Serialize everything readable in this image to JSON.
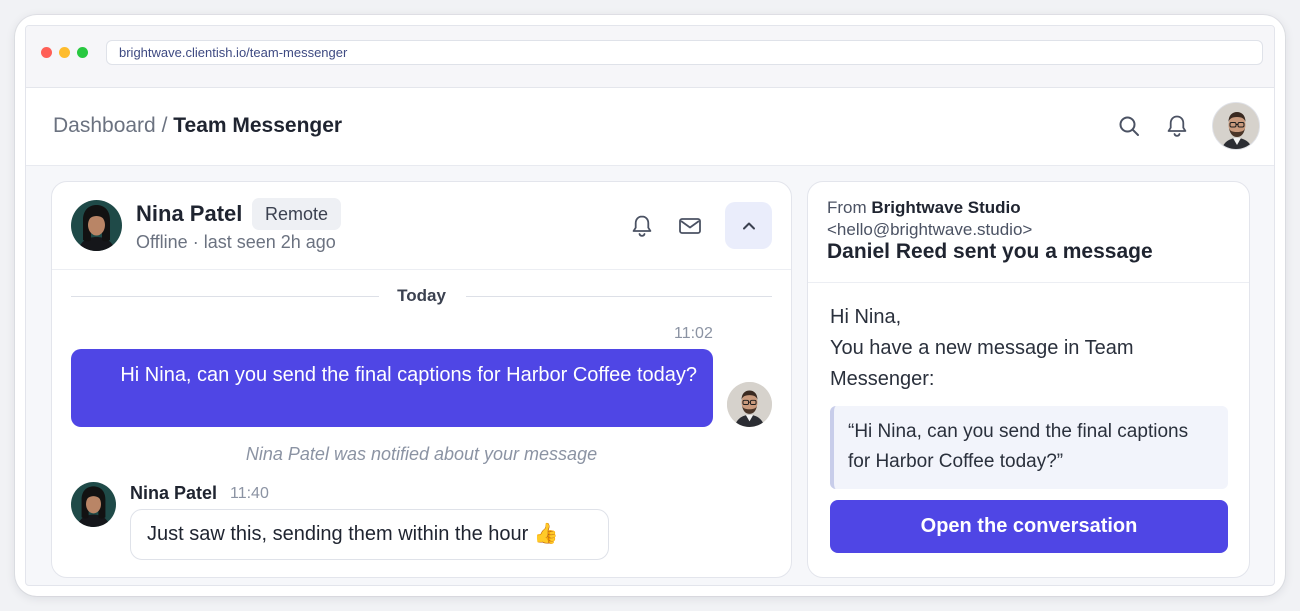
{
  "browser": {
    "url": "brightwave.clientish.io/team-messenger"
  },
  "header": {
    "breadcrumb_parent": "Dashboard",
    "breadcrumb_separator": " / ",
    "breadcrumb_current": "Team Messenger"
  },
  "chat": {
    "contact_name": "Nina Patel",
    "contact_tag": "Remote",
    "contact_status": "Offline · last seen 2h ago",
    "day_divider": "Today",
    "outgoing": {
      "time": "11:02",
      "text": "Hi Nina, can you send the final captions for Harbor Coffee today?"
    },
    "notice": "Nina Patel was notified about your message",
    "incoming": {
      "sender": "Nina Patel",
      "time": "11:40",
      "text": "Just saw this, sending them within the hour 👍"
    }
  },
  "email": {
    "from_label": "From ",
    "from_name": "Brightwave Studio",
    "from_address": "<hello@brightwave.studio>",
    "subject": "Daniel Reed sent you a message",
    "greeting": "Hi Nina,",
    "body": "You have a new message in Team Messenger:",
    "quote": "“Hi Nina, can you send the final captions for Harbor Coffee today?”",
    "cta_label": "Open the conversation"
  },
  "colors": {
    "accent": "#4f46e5",
    "accent_soft": "#eaedfb",
    "muted_text": "#6b7280"
  },
  "icons": {
    "top_search": "search-icon",
    "top_notifications": "bell-icon",
    "chat_bell": "bell-icon",
    "chat_mail": "mail-icon",
    "chat_collapse": "chevron-up-icon"
  }
}
